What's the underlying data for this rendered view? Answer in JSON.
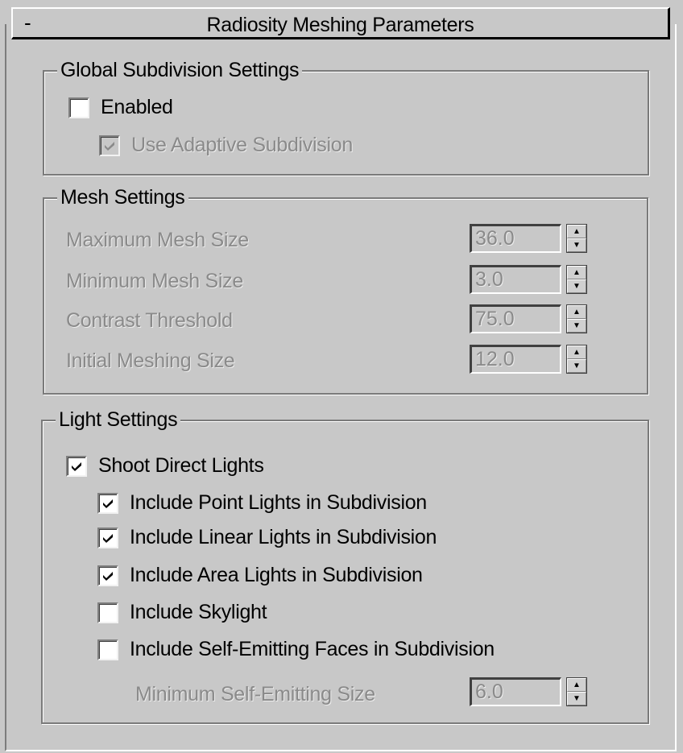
{
  "panel": {
    "collapse_symbol": "-",
    "title": "Radiosity Meshing Parameters"
  },
  "global_subdivision": {
    "title": "Global Subdivision Settings",
    "enabled": {
      "label": "Enabled",
      "checked": false,
      "disabled": false
    },
    "use_adaptive": {
      "label": "Use Adaptive Subdivision",
      "checked": true,
      "disabled": true
    }
  },
  "mesh_settings": {
    "title": "Mesh Settings",
    "fields": [
      {
        "label": "Maximum Mesh Size",
        "value": "36.0"
      },
      {
        "label": "Minimum Mesh Size",
        "value": "3.0"
      },
      {
        "label": "Contrast Threshold",
        "value": "75.0"
      },
      {
        "label": "Initial Meshing Size",
        "value": "12.0"
      }
    ]
  },
  "light_settings": {
    "title": "Light Settings",
    "shoot_direct": {
      "label": "Shoot Direct Lights",
      "checked": true
    },
    "include_point": {
      "label": "Include Point Lights in Subdivision",
      "checked": true
    },
    "include_linear": {
      "label": "Include Linear Lights in Subdivision",
      "checked": true
    },
    "include_area": {
      "label": "Include Area Lights in Subdivision",
      "checked": true
    },
    "include_skylight": {
      "label": "Include Skylight",
      "checked": false
    },
    "include_self_emitting": {
      "label": "Include Self-Emitting Faces in Subdivision",
      "checked": false
    },
    "min_self_emitting": {
      "label": "Minimum Self-Emitting Size",
      "value": "6.0"
    }
  },
  "icons": {
    "check": "checkmark-icon",
    "spin_up": "spinner-up-arrow-icon",
    "spin_down": "spinner-down-arrow-icon"
  }
}
